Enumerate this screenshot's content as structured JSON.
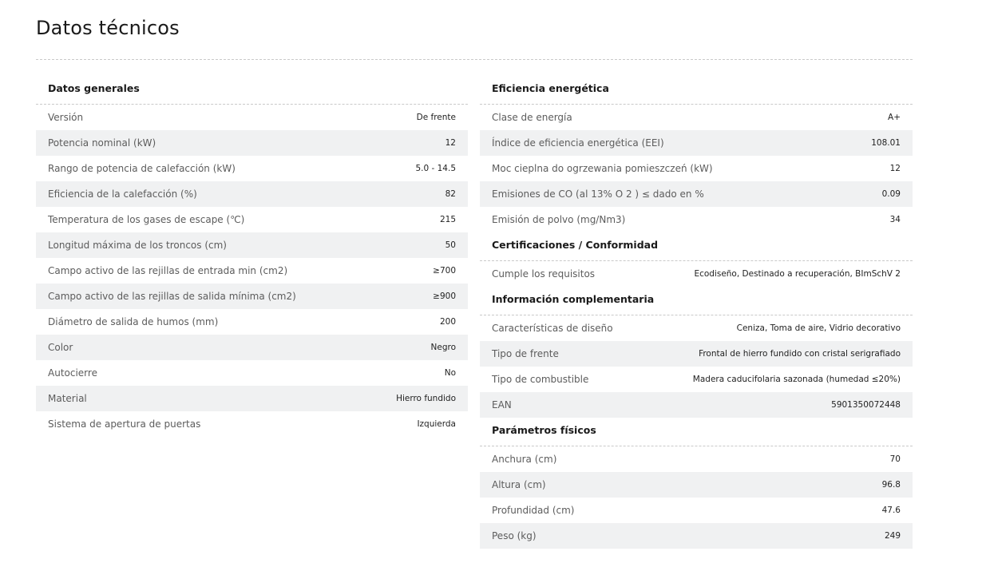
{
  "page": {
    "title": "Datos técnicos"
  },
  "sections": {
    "general": {
      "title": "Datos generales",
      "rows": [
        {
          "label": "Versión",
          "value": "De frente"
        },
        {
          "label": "Potencia nominal (kW)",
          "value": "12"
        },
        {
          "label": "Rango de potencia de calefacción (kW)",
          "value": "5.0 - 14.5"
        },
        {
          "label": "Eficiencia de la calefacción (%)",
          "value": "82"
        },
        {
          "label": "Temperatura de los gases de escape (℃)",
          "value": "215"
        },
        {
          "label": "Longitud máxima de los troncos (cm)",
          "value": "50"
        },
        {
          "label": "Campo activo de las rejillas de entrada min (cm2)",
          "value": "≥700"
        },
        {
          "label": "Campo activo de las rejillas de salida mínima (cm2)",
          "value": "≥900"
        },
        {
          "label": "Diámetro de salida de humos (mm)",
          "value": "200"
        },
        {
          "label": "Color",
          "value": "Negro"
        },
        {
          "label": "Autocierre",
          "value": "No"
        },
        {
          "label": "Material",
          "value": "Hierro fundido"
        },
        {
          "label": "Sistema de apertura de puertas",
          "value": "Izquierda"
        }
      ]
    },
    "efficiency": {
      "title": "Eficiencia energética",
      "rows": [
        {
          "label": "Clase de energía",
          "value": "A+"
        },
        {
          "label": "Índice de eficiencia energética (EEI)",
          "value": "108.01"
        },
        {
          "label": "Moc cieplna do ogrzewania pomieszczeń (kW)",
          "value": "12"
        },
        {
          "label": "Emisiones de CO (al 13% O 2 ) ≤ dado en %",
          "value": "0.09"
        },
        {
          "label": "Emisión de polvo (mg/Nm3)",
          "value": "34"
        }
      ]
    },
    "certifications": {
      "title": "Certificaciones / Conformidad",
      "rows": [
        {
          "label": "Cumple los requisitos",
          "value": "Ecodiseño, Destinado a recuperación, BImSchV 2"
        }
      ]
    },
    "complementary": {
      "title": "Información complementaria",
      "rows": [
        {
          "label": "Características de diseño",
          "value": "Ceniza, Toma de aire, Vidrio decorativo"
        },
        {
          "label": "Tipo de frente",
          "value": "Frontal de hierro fundido con cristal serigrafiado"
        },
        {
          "label": "Tipo de combustible",
          "value": "Madera caducifolaria sazonada (humedad ≤20%)"
        },
        {
          "label": "EAN",
          "value": "5901350072448"
        }
      ]
    },
    "physical": {
      "title": "Parámetros físicos",
      "rows": [
        {
          "label": "Anchura (cm)",
          "value": "70"
        },
        {
          "label": "Altura (cm)",
          "value": "96.8"
        },
        {
          "label": "Profundidad (cm)",
          "value": "47.6"
        },
        {
          "label": "Peso (kg)",
          "value": "249"
        }
      ]
    }
  }
}
